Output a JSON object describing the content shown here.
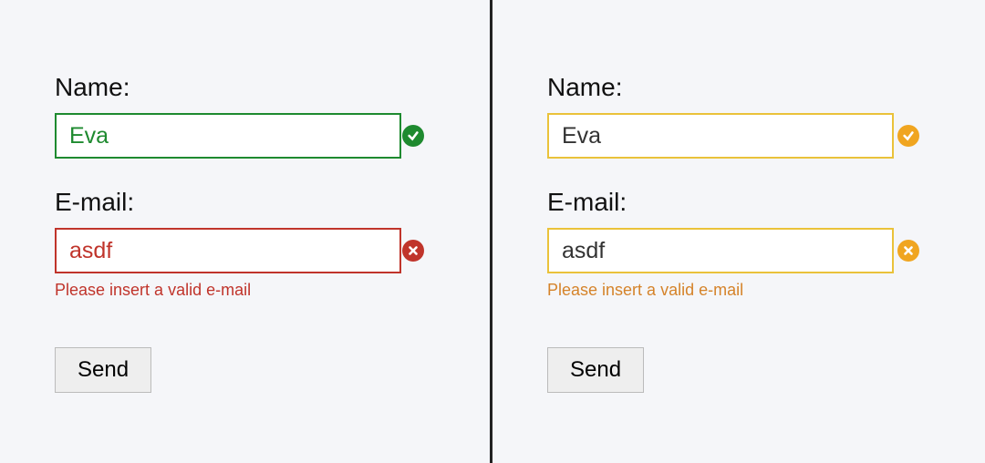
{
  "left": {
    "name": {
      "label": "Name:",
      "value": "Eva"
    },
    "email": {
      "label": "E-mail:",
      "value": "asdf",
      "error": "Please insert a valid e-mail"
    },
    "send_label": "Send"
  },
  "right": {
    "name": {
      "label": "Name:",
      "value": "Eva"
    },
    "email": {
      "label": "E-mail:",
      "value": "asdf",
      "error": "Please insert a valid e-mail"
    },
    "send_label": "Send"
  }
}
